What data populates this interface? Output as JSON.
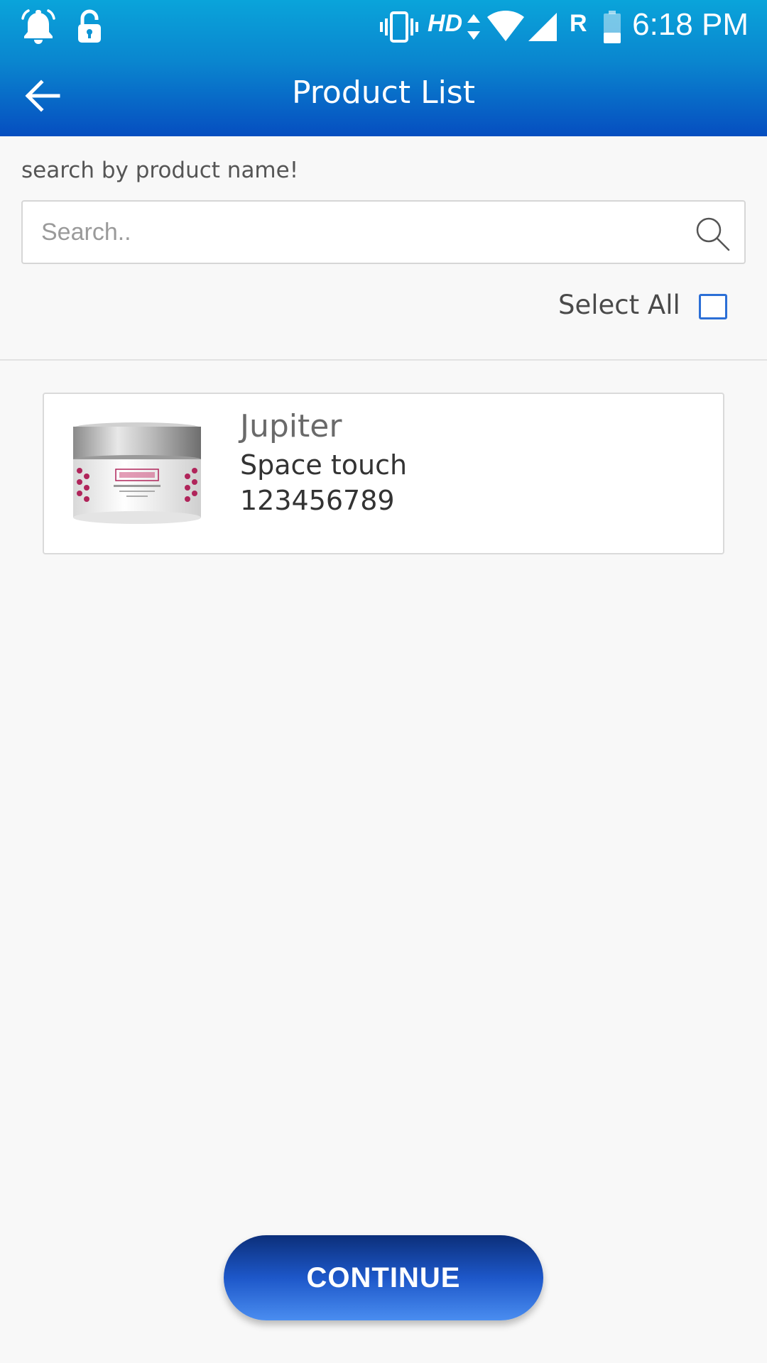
{
  "status_bar": {
    "time": "6:18 PM",
    "network_type": "HD",
    "roaming": "R",
    "icons": [
      "notification-bell-icon",
      "lock-icon",
      "vibrate-icon",
      "data-arrows-icon",
      "wifi-icon",
      "signal-icon",
      "battery-icon"
    ]
  },
  "app_bar": {
    "title": "Product List",
    "back_icon": "arrow-left-icon"
  },
  "search": {
    "label": "search by product name!",
    "placeholder": "Search..",
    "value": "",
    "icon": "search-icon"
  },
  "select_all": {
    "label": "Select All",
    "checked": false
  },
  "products": [
    {
      "name": "Jupiter",
      "brand": "Space touch",
      "code": "123456789",
      "image": "cream-jar-image"
    }
  ],
  "continue_button": {
    "label": "CONTINUE"
  },
  "colors": {
    "app_bar_gradient_top": "#0aa4da",
    "app_bar_gradient_bottom": "#064ec0",
    "accent": "#2c6fd6",
    "button_gradient_top": "#0c2f7a",
    "button_gradient_bottom": "#4a8df0",
    "background": "#f8f8f8"
  }
}
